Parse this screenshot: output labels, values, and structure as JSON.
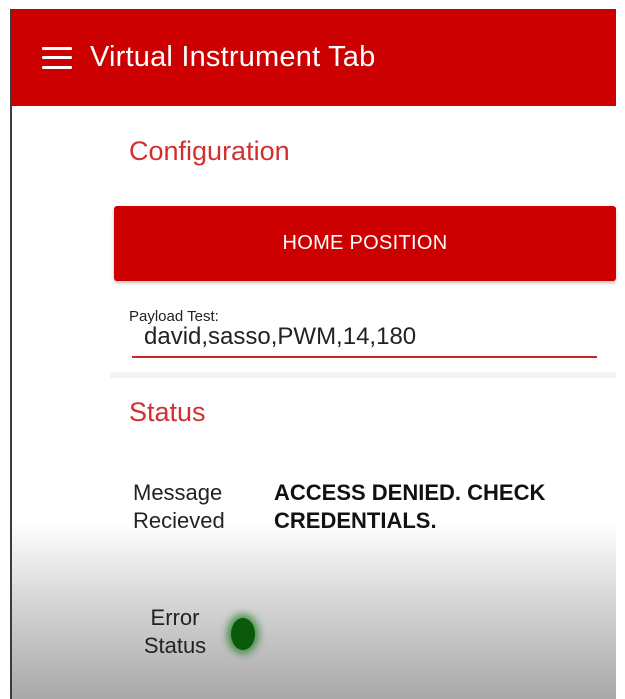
{
  "app_bar": {
    "title": "Virtual Instrument Tab",
    "icon": "menu-icon",
    "color": "#cc0000"
  },
  "configuration": {
    "title": "Configuration",
    "home_button_label": "HOME POSITION",
    "payload_field": {
      "label": "Payload Test:",
      "value": "david,sasso,PWM,14,180"
    }
  },
  "status": {
    "title": "Status",
    "message_label_line1": "Message",
    "message_label_line2": "Recieved",
    "message_value": "ACCESS DENIED. CHECK CREDENTIALS.",
    "error_label_line1": "Error",
    "error_label_line2": "Status",
    "error_indicator_color": "#0a5a0a"
  }
}
